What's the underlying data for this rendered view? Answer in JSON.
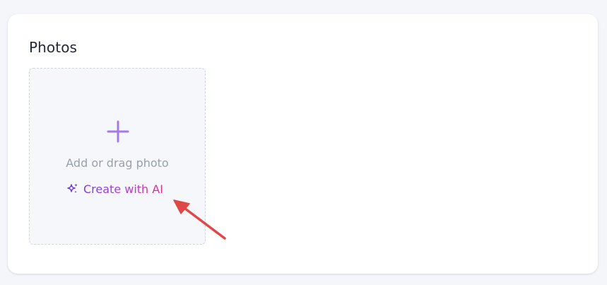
{
  "photos": {
    "title": "Photos",
    "upload": {
      "icon": "plus-icon",
      "label": "Add or drag photo"
    },
    "ai_link": {
      "icon": "sparkle-icon",
      "label": "Create with AI"
    }
  },
  "colors": {
    "page_background": "#f4f6f9",
    "card_background": "#ffffff",
    "title": "#1f2937",
    "tile_background": "#f5f7fa",
    "tile_border": "#cfd5de",
    "plus_icon": "#a47ae8",
    "muted_text": "#9aa0aa",
    "ai_gradient_start": "#7c3aed",
    "ai_gradient_end": "#dc2f8e",
    "annotation_arrow": "#e04848"
  }
}
